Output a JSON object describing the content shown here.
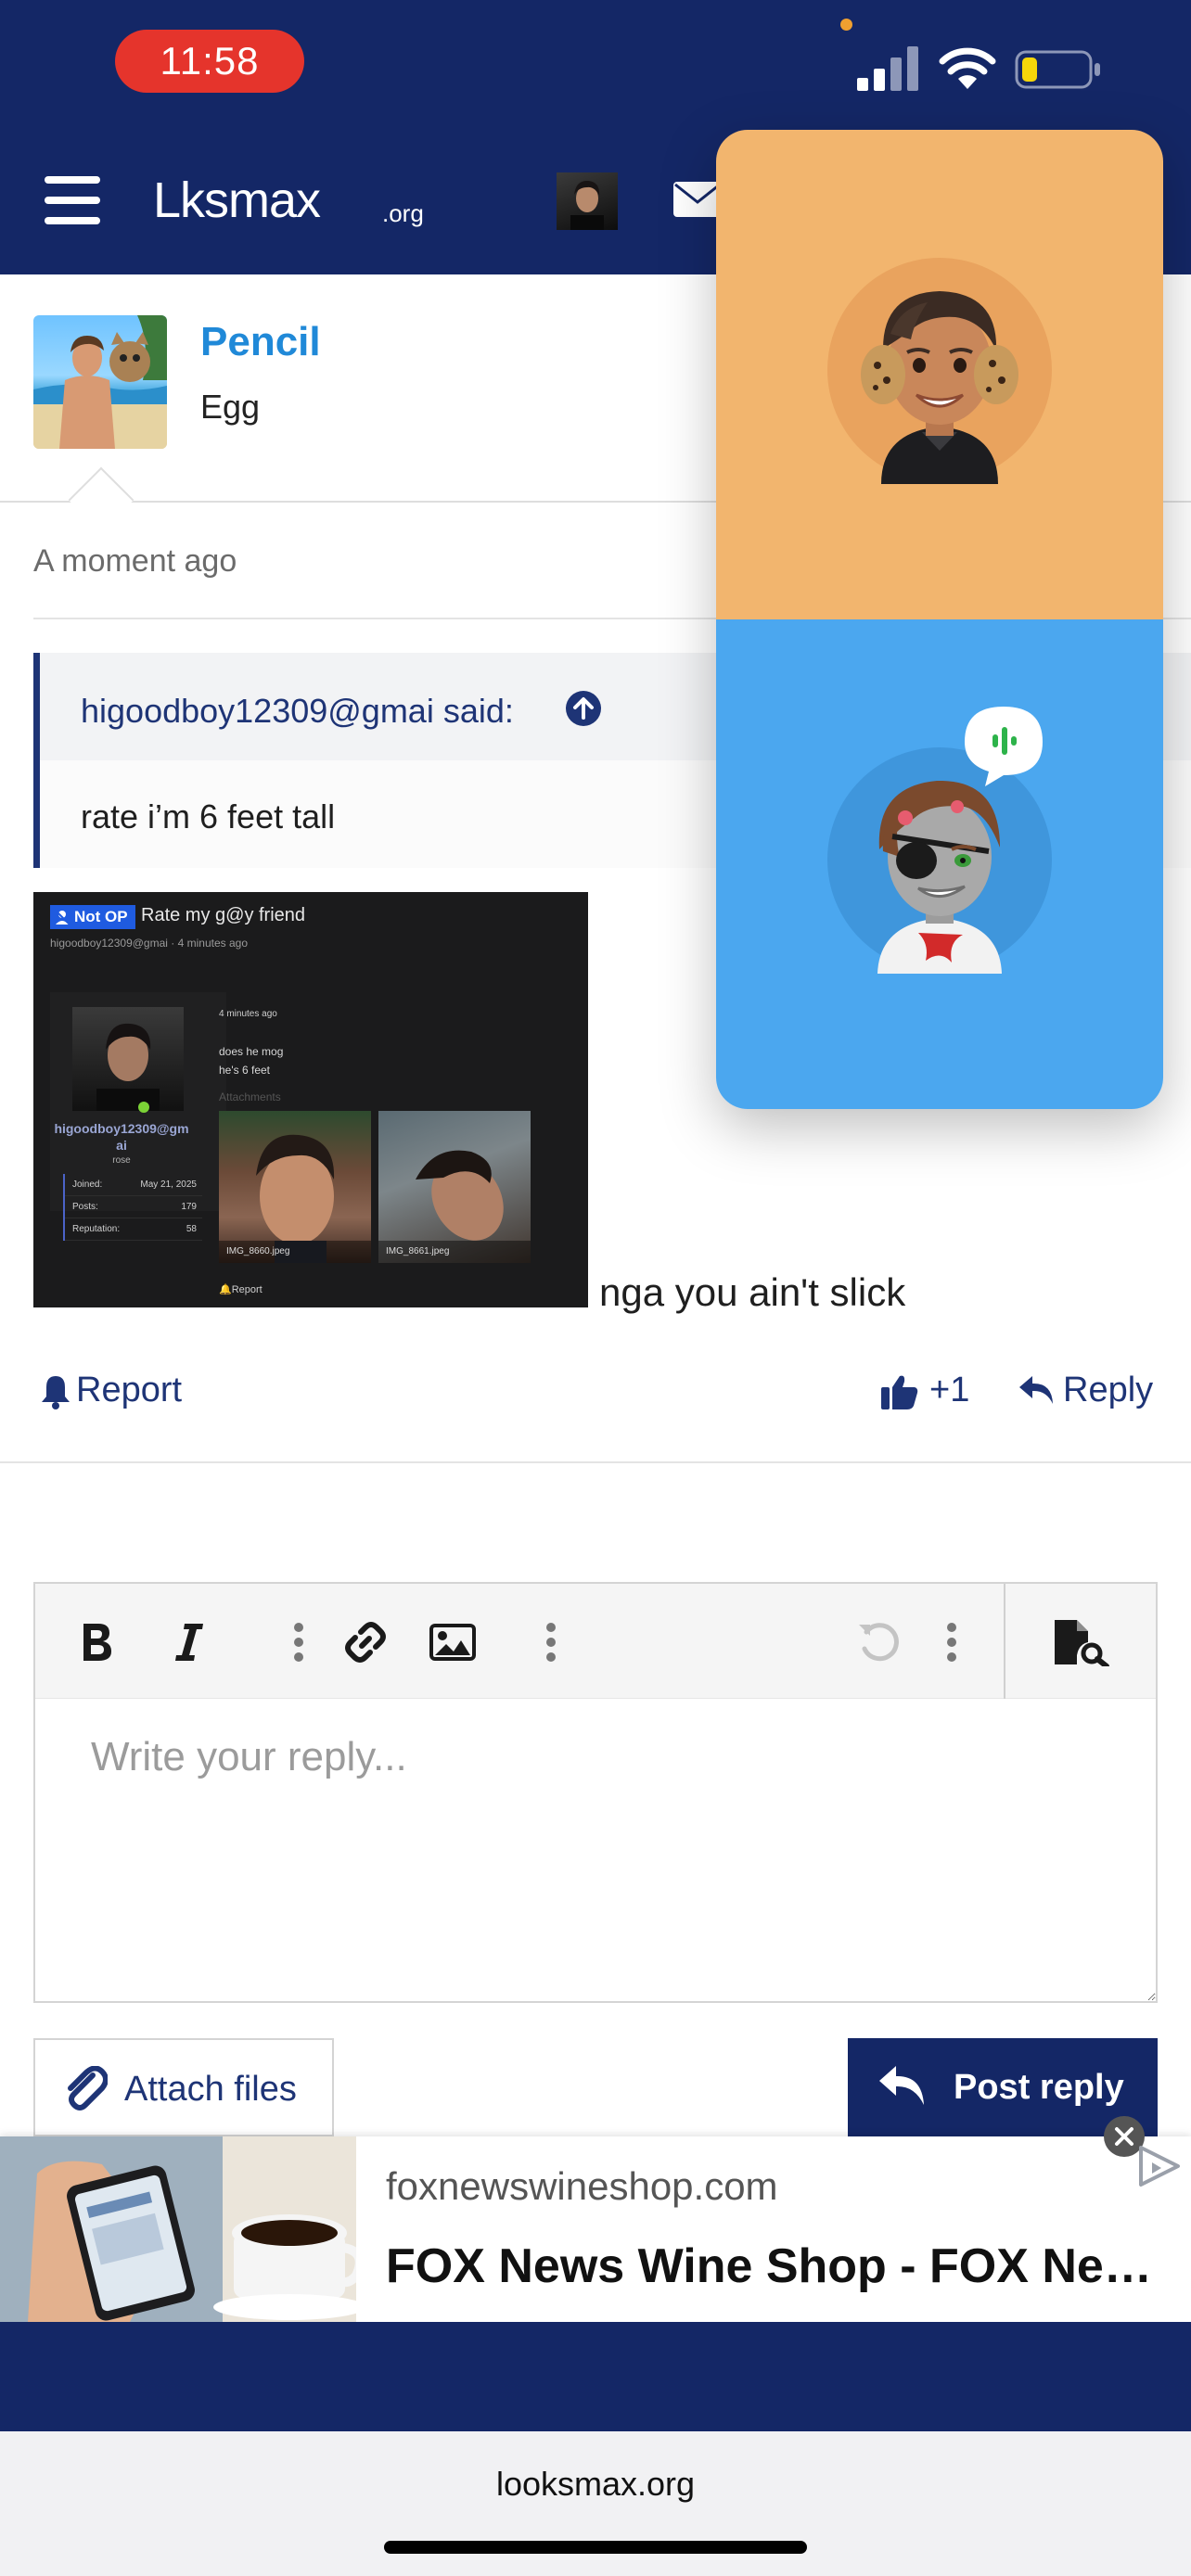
{
  "status_bar": {
    "time": "11:58"
  },
  "nav": {
    "logo": "Lksmax",
    "logo_suffix": ".org"
  },
  "post": {
    "username": "Pencil",
    "user_title": "Egg",
    "time": "A moment ago",
    "quote": {
      "author": "higoodboy12309@gmai said:",
      "text": "rate i’m 6 feet tall"
    },
    "text": "nga you ain't slick",
    "actions": {
      "report": "Report",
      "reactions": "+1",
      "reply": "Reply"
    }
  },
  "embedded_screenshot": {
    "badge": "Not OP",
    "title": "Rate my g@y friend",
    "meta": "higoodboy12309@gmai · 4 minutes ago",
    "time": "4 minutes ago",
    "body_line1": "does he mog",
    "body_line2": "he's 6 feet",
    "attachments_label": "Attachments",
    "username_line1": "higoodboy12309@gm",
    "username_line2": "ai",
    "user_title": "rose",
    "stats": [
      {
        "label": "Joined:",
        "value": "May 21, 2025"
      },
      {
        "label": "Posts:",
        "value": "179"
      },
      {
        "label": "Reputation:",
        "value": "58"
      }
    ],
    "image1": "IMG_8660.jpeg",
    "image2": "IMG_8661.jpeg",
    "report": "Report"
  },
  "editor": {
    "placeholder": "Write your reply..."
  },
  "buttons": {
    "attach": "Attach files",
    "post_reply": "Post reply"
  },
  "ad": {
    "domain": "foxnewswineshop.com",
    "title": "FOX News Wine Shop - FOX News Wine Shop"
  },
  "browser": {
    "url": "looksmax.org"
  },
  "colors": {
    "brand_navy": "#142766",
    "link_blue": "#2089d8",
    "call_top": "#f2b56e",
    "call_bottom": "#4ba7ef"
  }
}
